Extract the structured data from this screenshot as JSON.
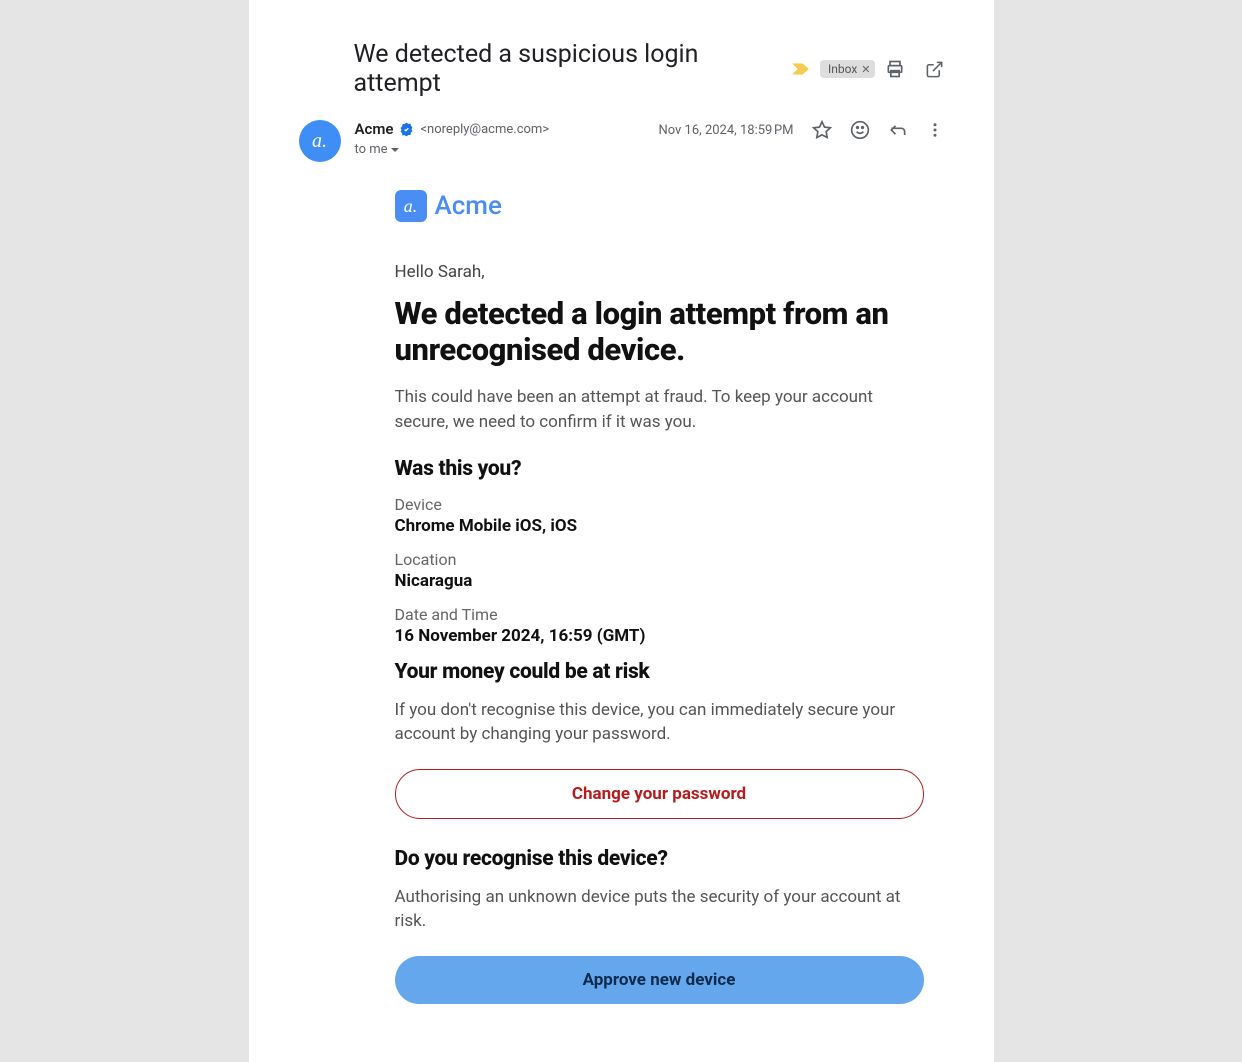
{
  "header": {
    "subject": "We detected a suspicious login attempt",
    "label": "Inbox"
  },
  "meta": {
    "avatar_initial": "a.",
    "sender_name": "Acme",
    "sender_email": "<noreply@acme.com>",
    "to_text": "to me",
    "timestamp": "Nov 16, 2024, 18:59 PM"
  },
  "body": {
    "brand_mark": "a.",
    "brand_name": "Acme",
    "greeting": "Hello Sarah,",
    "main_heading": "We detected a login attempt from an unrecognised device.",
    "intro_para": "This could have been an attempt at fraud. To keep your account secure, we need to confirm if it was you.",
    "was_this_you_heading": "Was this you?",
    "device_label": "Device",
    "device_value": "Chrome Mobile iOS, iOS",
    "location_label": "Location",
    "location_value": "Nicaragua",
    "datetime_label": "Date and Time",
    "datetime_value": "16 November 2024, 16:59 (GMT)",
    "risk_heading": "Your money could be at risk",
    "risk_para": "If you don't recognise this device, you can immediately secure your account by changing your password.",
    "change_pw_button": "Change your password",
    "recognise_heading": "Do you recognise this device?",
    "recognise_para": "Authorising an unknown device puts the security of your account at risk.",
    "approve_button": "Approve new device"
  }
}
